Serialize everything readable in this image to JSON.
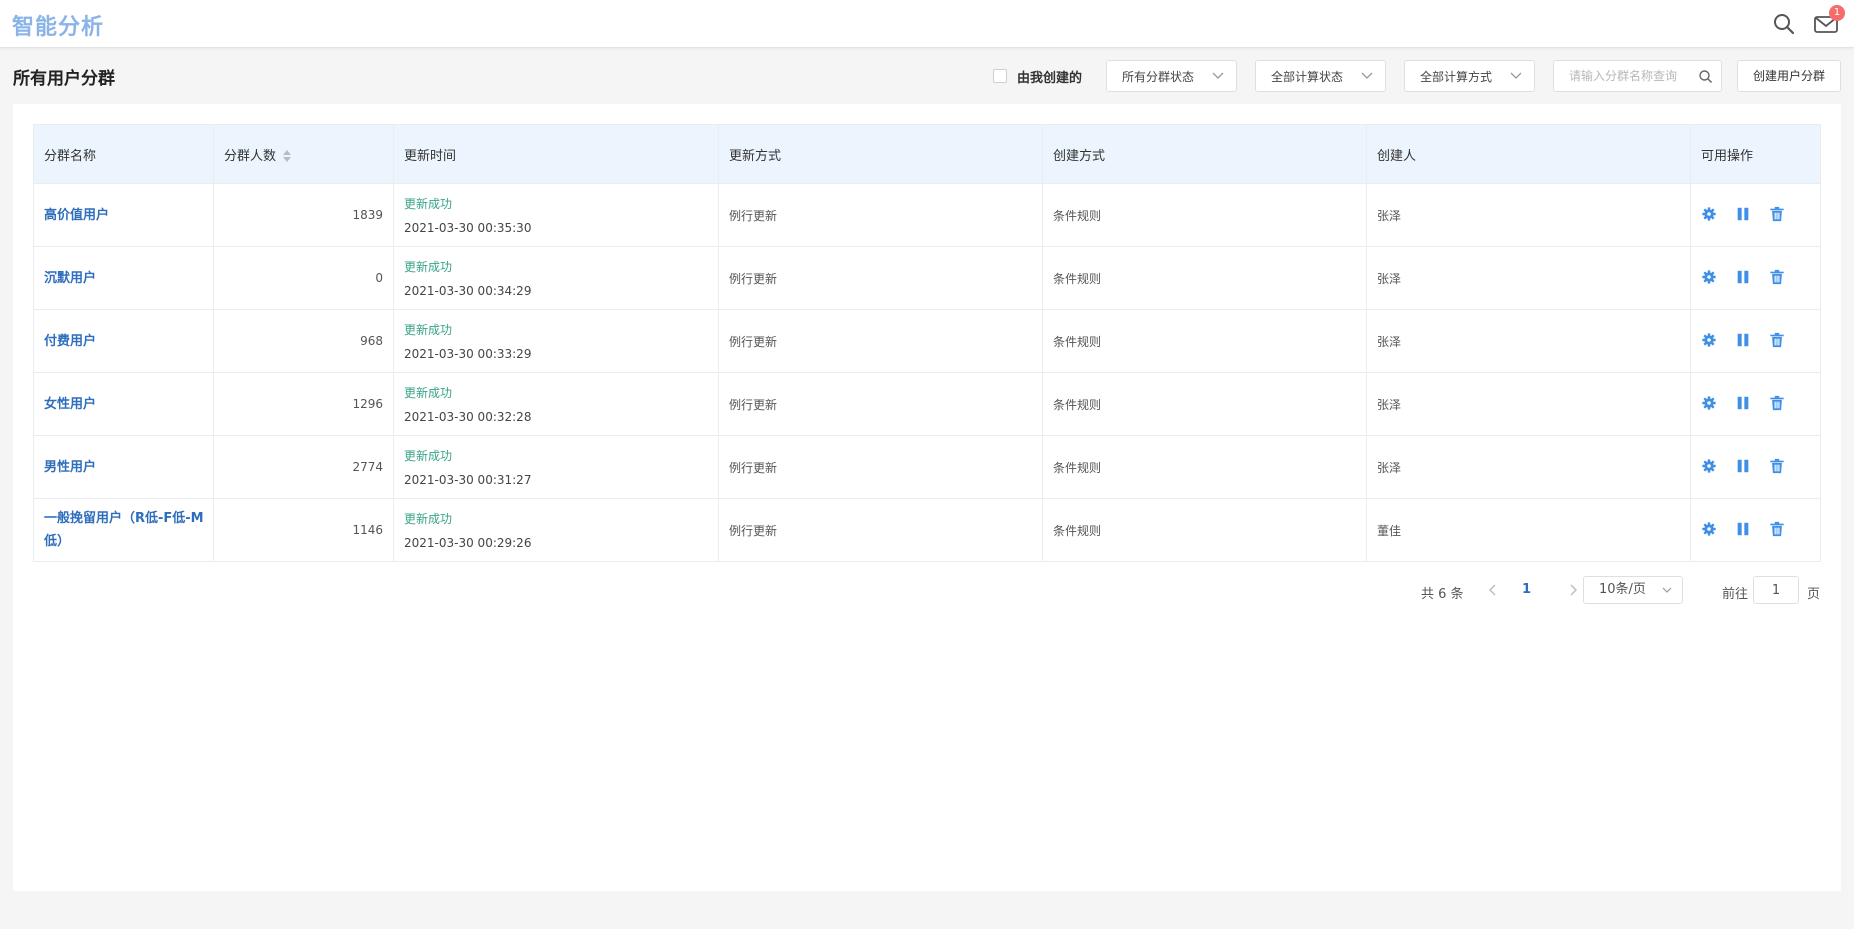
{
  "app": {
    "title": "智能分析",
    "mail_badge": "1"
  },
  "icons": {
    "search": "search-icon",
    "mail": "mail-icon",
    "settings": "gear-icon",
    "pause": "pause-icon",
    "delete": "trash-icon"
  },
  "colors": {
    "brand": "#8ab4e8",
    "link": "#2f6ebd",
    "success": "#3aa38a",
    "header_bg": "#ecf5fe",
    "action": "#3f8fe6"
  },
  "toolbar": {
    "title": "所有用户分群",
    "mine_label": "由我创建的",
    "status_select": "所有分群状态",
    "compute_status_select": "全部计算状态",
    "compute_method_select": "全部计算方式",
    "search_placeholder": "请输入分群名称查询",
    "create_label": "创建用户分群"
  },
  "table": {
    "columns": [
      "分群名称",
      "分群人数",
      "更新时间",
      "更新方式",
      "创建方式",
      "创建人",
      "可用操作"
    ],
    "rows": [
      {
        "name": "高价值用户",
        "count": "1839",
        "status": "更新成功",
        "time": "2021-03-30 00:35:30",
        "update_method": "例行更新",
        "create_method": "条件规则",
        "creator": "张泽"
      },
      {
        "name": "沉默用户",
        "count": "0",
        "status": "更新成功",
        "time": "2021-03-30 00:34:29",
        "update_method": "例行更新",
        "create_method": "条件规则",
        "creator": "张泽"
      },
      {
        "name": "付费用户",
        "count": "968",
        "status": "更新成功",
        "time": "2021-03-30 00:33:29",
        "update_method": "例行更新",
        "create_method": "条件规则",
        "creator": "张泽"
      },
      {
        "name": "女性用户",
        "count": "1296",
        "status": "更新成功",
        "time": "2021-03-30 00:32:28",
        "update_method": "例行更新",
        "create_method": "条件规则",
        "creator": "张泽"
      },
      {
        "name": "男性用户",
        "count": "2774",
        "status": "更新成功",
        "time": "2021-03-30 00:31:27",
        "update_method": "例行更新",
        "create_method": "条件规则",
        "creator": "张泽"
      },
      {
        "name": "一般挽留用户（R低-F低-M低）",
        "count": "1146",
        "status": "更新成功",
        "time": "2021-03-30 00:29:26",
        "update_method": "例行更新",
        "create_method": "条件规则",
        "creator": "董佳"
      }
    ]
  },
  "pagination": {
    "total": "共 6 条",
    "current": "1",
    "page_size": "10条/页",
    "goto_label": "前往",
    "goto_value": "1",
    "page_label": "页"
  }
}
